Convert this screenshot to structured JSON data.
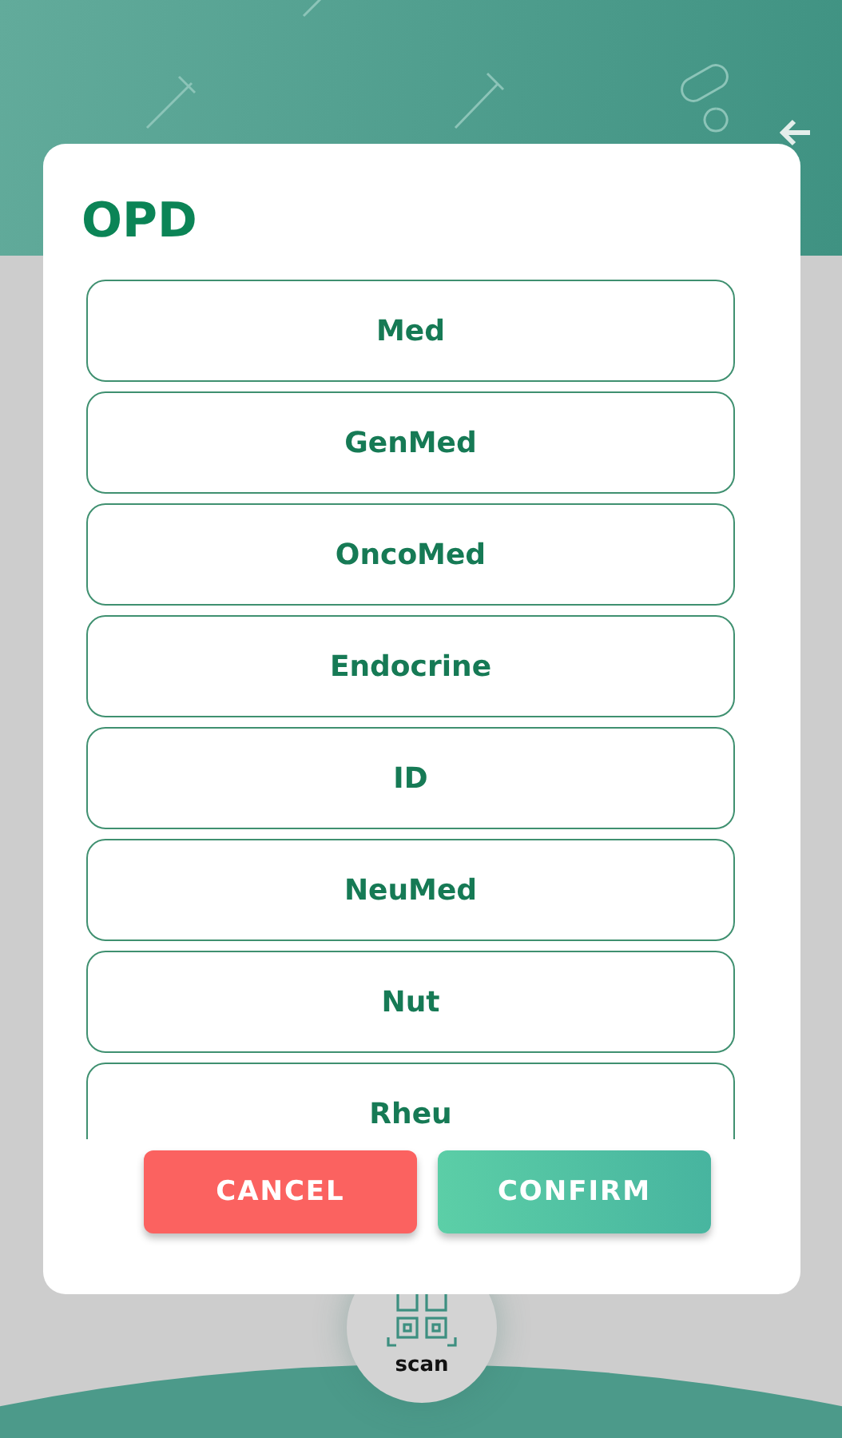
{
  "dialog": {
    "title": "OPD",
    "options": [
      {
        "label": "Med"
      },
      {
        "label": "GenMed"
      },
      {
        "label": "OncoMed"
      },
      {
        "label": "Endocrine"
      },
      {
        "label": "ID"
      },
      {
        "label": "NeuMed"
      },
      {
        "label": "Nut"
      },
      {
        "label": "Rheu"
      }
    ],
    "buttons": [
      {
        "label": "CANCEL",
        "kind": "cancel"
      },
      {
        "label": "CONFIRM",
        "kind": "confirm"
      }
    ]
  },
  "scan_button": {
    "label": "scan"
  }
}
